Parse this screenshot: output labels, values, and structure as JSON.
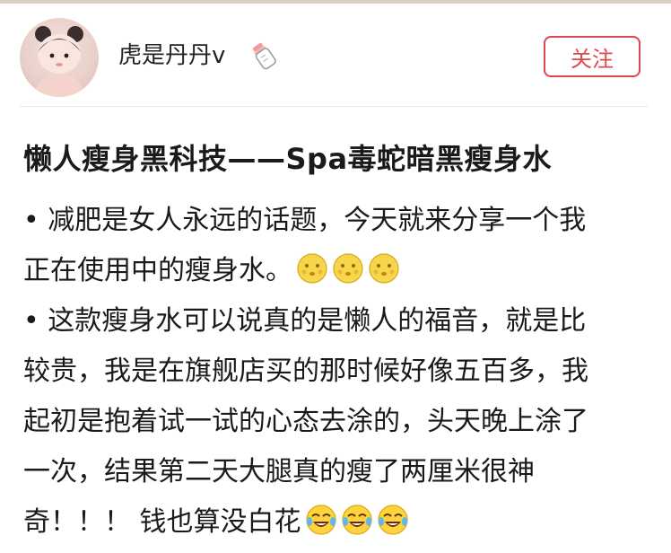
{
  "header": {
    "username": "虎是丹丹v",
    "follow_label": "关注",
    "accent_color": "#e0474c"
  },
  "post": {
    "title": "懒人瘦身黑科技——Spa毒蛇暗黑瘦身水",
    "paragraph1": {
      "lines": [
        "• 减肥是女人永远的话题，今天就来分享一个我",
        "正在使用中的瘦身水。"
      ],
      "emojis": [
        "moon-face-emoji",
        "moon-face-emoji",
        "moon-face-emoji"
      ]
    },
    "paragraph2": {
      "lines": [
        "• 这款瘦身水可以说真的是懒人的福音，就是比",
        "较贵，我是在旗舰店买的那时候好像五百多，我",
        "起初是抱着试一试的心态去涂的，头天晚上涂了",
        "一次，结果第二天大腿真的瘦了两厘米很神",
        "奇！！！ 钱也算没白花"
      ],
      "emojis": [
        "tears-of-joy-emoji",
        "tears-of-joy-emoji",
        "tears-of-joy-emoji"
      ]
    }
  },
  "icons": {
    "avatar": "user-avatar-girl",
    "badge": "baby-bottle-icon"
  }
}
